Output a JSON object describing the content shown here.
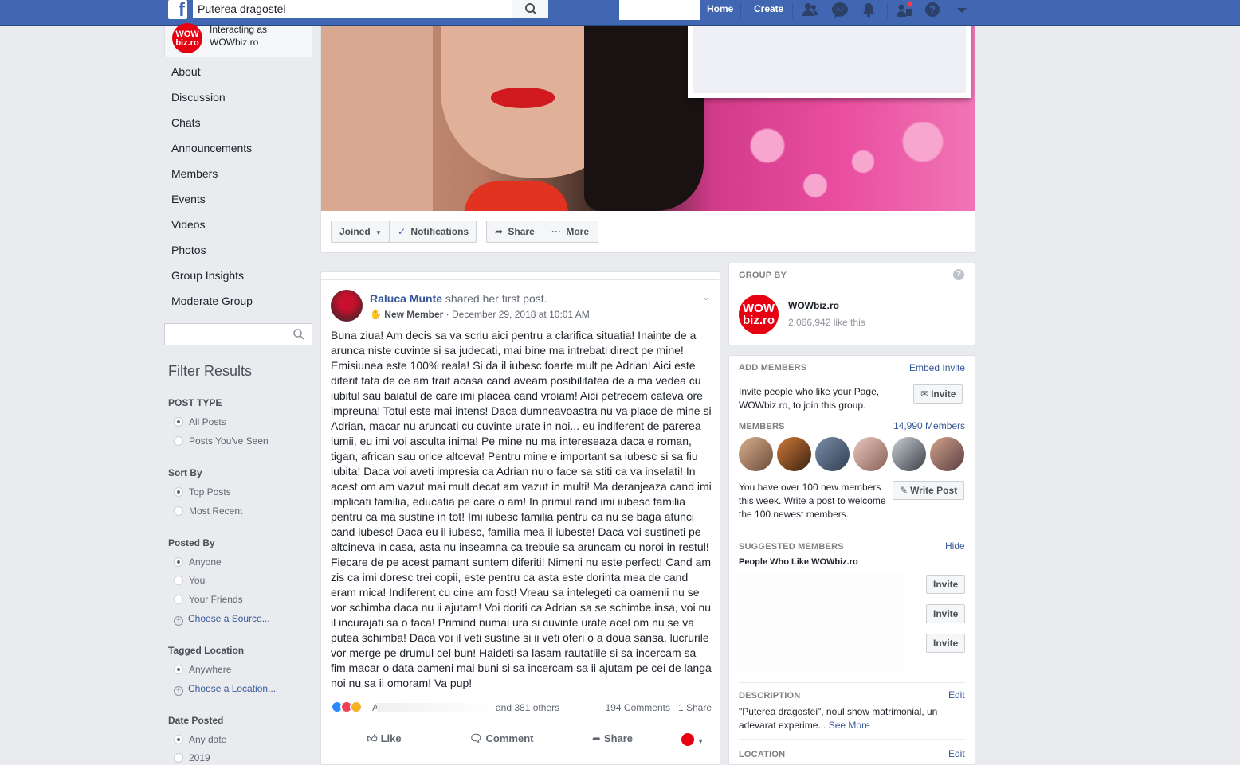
{
  "topbar": {
    "logo": "f",
    "search_value": "Puterea dragostei",
    "home": "Home",
    "create": "Create",
    "icons": [
      "friends-icon",
      "messenger-icon",
      "notifications-icon",
      "group-requests-icon",
      "help-icon",
      "dropdown-icon"
    ]
  },
  "interacting": {
    "line1": "Interacting as",
    "line2": "WOWbiz.ro",
    "logo_top": "WOW",
    "logo_bottom": "biz.ro"
  },
  "leftnav": [
    "About",
    "Discussion",
    "Chats",
    "Announcements",
    "Members",
    "Events",
    "Videos",
    "Photos",
    "Group Insights",
    "Moderate Group"
  ],
  "filters": {
    "title": "Filter Results",
    "post_type": {
      "label": "POST TYPE",
      "options": [
        "All Posts",
        "Posts You've Seen"
      ]
    },
    "sort_by": {
      "label": "Sort By",
      "options": [
        "Top Posts",
        "Most Recent"
      ]
    },
    "posted_by": {
      "label": "Posted By",
      "options": [
        "Anyone",
        "You",
        "Your Friends"
      ],
      "link": "Choose a Source..."
    },
    "tagged_location": {
      "label": "Tagged Location",
      "options": [
        "Anywhere"
      ],
      "link": "Choose a Location..."
    },
    "date_posted": {
      "label": "Date Posted",
      "options": [
        "Any date",
        "2019"
      ]
    }
  },
  "cover_actions": {
    "joined": "Joined",
    "notifications": "Notifications",
    "share": "Share",
    "more": "More"
  },
  "post": {
    "author": "Raluca Munte",
    "action": "shared her first post.",
    "badge": "New Member",
    "date": "December 29, 2018 at 10:01 AM",
    "body": "Buna ziua! Am decis sa va scriu aici pentru a clarifica situatia! Inainte de a arunca niste cuvinte si sa judecati, mai bine ma intrebati direct pe mine! Emisiunea este 100% reala! Si da il iubesc foarte mult pe Adrian! Aici este diferit fata de ce am trait acasa cand aveam posibilitatea de a ma vedea cu iubitul sau baiatul de care imi placea cand vroiam! Aici petrecem cateva ore impreuna! Totul este mai intens! Daca dumneavoastra nu va place de mine si Adrian, macar nu aruncati cu cuvinte urate in noi... eu indiferent de parerea lumii, eu imi voi asculta inima! Pe mine nu ma intereseaza daca e roman, tigan, african sau orice altceva! Pentru mine e important sa iubesc si sa fiu iubita! Daca voi aveti impresia ca Adrian nu o face sa stiti ca va inselati! In acest om am vazut mai mult decat am vazut in multi! Ma deranjeaza cand imi implicati familia, educatia pe care o am! In primul rand imi iubesc familia pentru ca ma sustine in tot! Imi iubesc familia pentru ca nu se baga atunci cand iubesc! Daca eu il iubesc, familia mea il iubeste! Daca voi sustineti pe altcineva in casa, asta nu inseamna ca trebuie sa aruncam cu noroi in restul! Fiecare de pe acest pamant suntem diferiti! Nimeni nu este perfect! Cand am zis ca imi doresc trei copii, este pentru ca asta este dorinta mea de cand eram mica! Indiferent cu cine am fost! Vreau sa intelegeti ca oamenii nu se vor schimba daca nu ii ajutam! Voi doriti ca Adrian sa se schimbe insa, voi nu il incurajati sa o faca! Primind numai ura si cuvinte urate acel om nu se va putea schimba! Daca voi il veti sustine si ii veti oferi o a doua sansa, lucrurile vor merge pe drumul cel bun! Haideti sa lasam rautatiile si sa incercam sa fim macar o data oameni mai buni si sa incercam sa ii ajutam pe cei de langa noi nu sa ii omoram! Va pup!",
    "reactions_prefix": "A",
    "reactions_others": "and 381 others",
    "comments": "194 Comments",
    "shares": "1 Share",
    "like": "Like",
    "comment": "Comment",
    "share": "Share"
  },
  "group_by": {
    "label": "GROUP BY",
    "page_name": "WOWbiz.ro",
    "likes": "2,066,942 like this"
  },
  "add_members": {
    "label": "ADD MEMBERS",
    "embed": "Embed Invite",
    "text": "Invite people who like your Page, WOWbiz.ro, to join this group.",
    "invite": "Invite",
    "members_label": "MEMBERS",
    "members_count": "14,990 Members",
    "new_members_text": "You have over 100 new members this week. Write a post to welcome the 100 newest members.",
    "write_post": "Write Post",
    "suggested_label": "SUGGESTED MEMBERS",
    "hide": "Hide",
    "people_like": "People Who Like WOWbiz.ro",
    "invite_buttons": [
      "Invite",
      "Invite",
      "Invite"
    ],
    "description_label": "DESCRIPTION",
    "edit": "Edit",
    "description": "\"Puterea dragostei\", noul show matrimonial, un adevarat experime...",
    "see_more": "See More",
    "location_label": "LOCATION",
    "location_edit": "Edit"
  },
  "colors": {
    "fb_blue": "#4267b2",
    "link": "#365899",
    "wow_red": "#e60012"
  }
}
